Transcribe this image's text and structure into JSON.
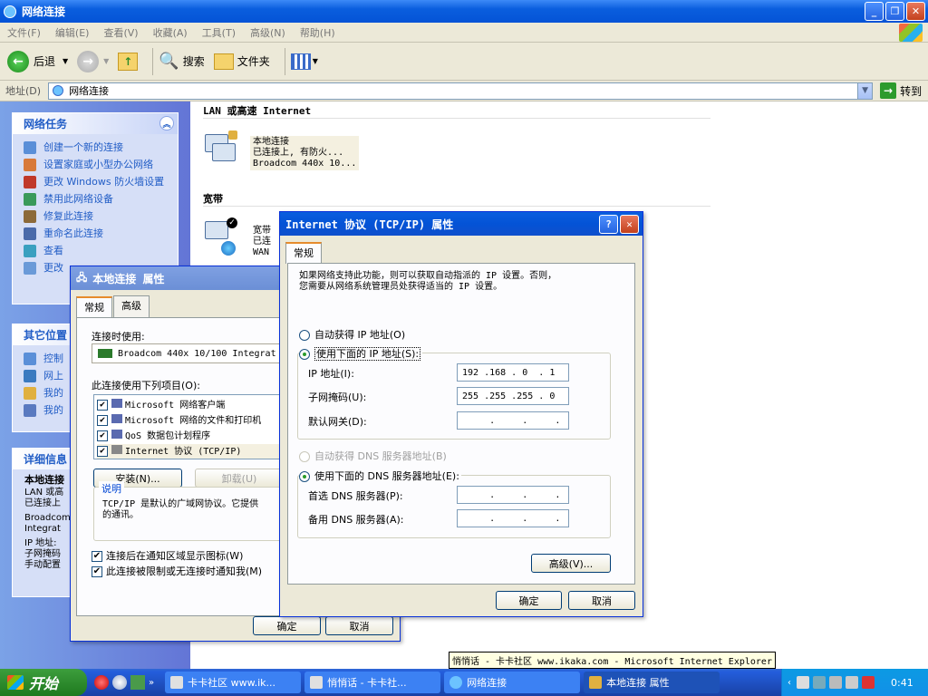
{
  "window": {
    "title": "网络连接"
  },
  "menu": [
    "文件(F)",
    "编辑(E)",
    "查看(V)",
    "收藏(A)",
    "工具(T)",
    "高级(N)",
    "帮助(H)"
  ],
  "toolbar": {
    "back": "后退",
    "search": "搜索",
    "folders": "文件夹"
  },
  "address": {
    "label": "地址(D)",
    "value": "网络连接",
    "go": "转到"
  },
  "tasks": {
    "title": "网络任务",
    "items": [
      "创建一个新的连接",
      "设置家庭或小型办公网络",
      "更改 Windows 防火墙设置",
      "禁用此网络设备",
      "修复此连接",
      "重命名此连接",
      "查看",
      "更改"
    ]
  },
  "other": {
    "title": "其它位置",
    "items": [
      "控制",
      "网上",
      "我的",
      "我的"
    ]
  },
  "details": {
    "title": "详细信息",
    "lines": [
      "本地连接",
      "LAN 或高",
      "已连接上",
      "Broadcom",
      "Integrat",
      "IP 地址:",
      "子网掩码",
      "手动配置"
    ]
  },
  "main": {
    "lan_header": "LAN 或高速 Internet",
    "lan_conn": {
      "name": "本地连接",
      "status": "已连接上, 有防火...",
      "device": "Broadcom 440x 10..."
    },
    "broadband_header": "宽带",
    "broadband_conn": {
      "name": "宽带",
      "status": "已连",
      "device": "WAN"
    }
  },
  "local_dialog": {
    "title": "本地连接 属性",
    "tabs": [
      "常规",
      "高级"
    ],
    "connect_using": "连接时使用:",
    "adapter": "Broadcom 440x 10/100 Integrat",
    "items_label": "此连接使用下列项目(O):",
    "items": [
      "Microsoft 网络客户端",
      "Microsoft 网络的文件和打印机",
      "QoS 数据包计划程序",
      "Internet 协议 (TCP/IP)"
    ],
    "install": "安装(N)...",
    "uninstall": "卸载(U)",
    "desc_title": "说明",
    "desc_text": "TCP/IP 是默认的广域网协议。它提供",
    "desc_text2": "的通讯。",
    "notify1": "连接后在通知区域显示图标(W)",
    "notify2": "此连接被限制或无连接时通知我(M)",
    "ok": "确定",
    "cancel": "取消"
  },
  "tcp_dialog": {
    "title": "Internet 协议 (TCP/IP) 属性",
    "tab": "常规",
    "intro1": "如果网络支持此功能，则可以获取自动指派的 IP 设置。否则，",
    "intro2": "您需要从网络系统管理员处获得适当的 IP 设置。",
    "auto_ip": "自动获得 IP 地址(O)",
    "manual_ip": "使用下面的 IP 地址(S):",
    "ip_label": "IP 地址(I):",
    "ip_value": "192 .168 . 0  . 1",
    "mask_label": "子网掩码(U):",
    "mask_value": "255 .255 .255 . 0",
    "gw_label": "默认网关(D):",
    "gw_value": "     .     .     .",
    "auto_dns": "自动获得 DNS 服务器地址(B)",
    "manual_dns": "使用下面的 DNS 服务器地址(E):",
    "dns1_label": "首选 DNS 服务器(P):",
    "dns1_value": "     .     .     .",
    "dns2_label": "备用 DNS 服务器(A):",
    "dns2_value": "     .     .     .",
    "advanced": "高级(V)...",
    "ok": "确定",
    "cancel": "取消"
  },
  "tooltip": "悄悄话 - 卡卡社区 www.ikaka.com - Microsoft Internet Explorer",
  "taskbar": {
    "start": "开始",
    "tasks": [
      "卡卡社区 www.ik...",
      "悄悄话 - 卡卡社...",
      "网络连接",
      "本地连接 属性"
    ],
    "time": "0:41"
  }
}
